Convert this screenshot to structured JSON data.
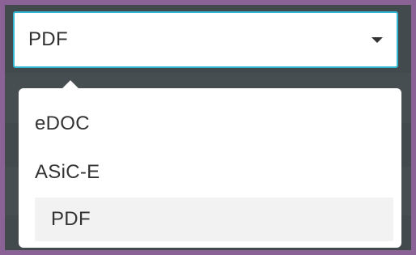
{
  "format_select": {
    "value": "PDF",
    "caret_icon": "caret-down-icon"
  },
  "dropdown": {
    "options": [
      {
        "label": "eDOC",
        "selected": false
      },
      {
        "label": "ASiC-E",
        "selected": false
      },
      {
        "label": "PDF",
        "selected": true
      }
    ]
  },
  "colors": {
    "frame_border": "#8a6296",
    "background": "#434a4d",
    "focus_border": "#31b7d1",
    "selected_option_bg": "#f2f2f2"
  }
}
